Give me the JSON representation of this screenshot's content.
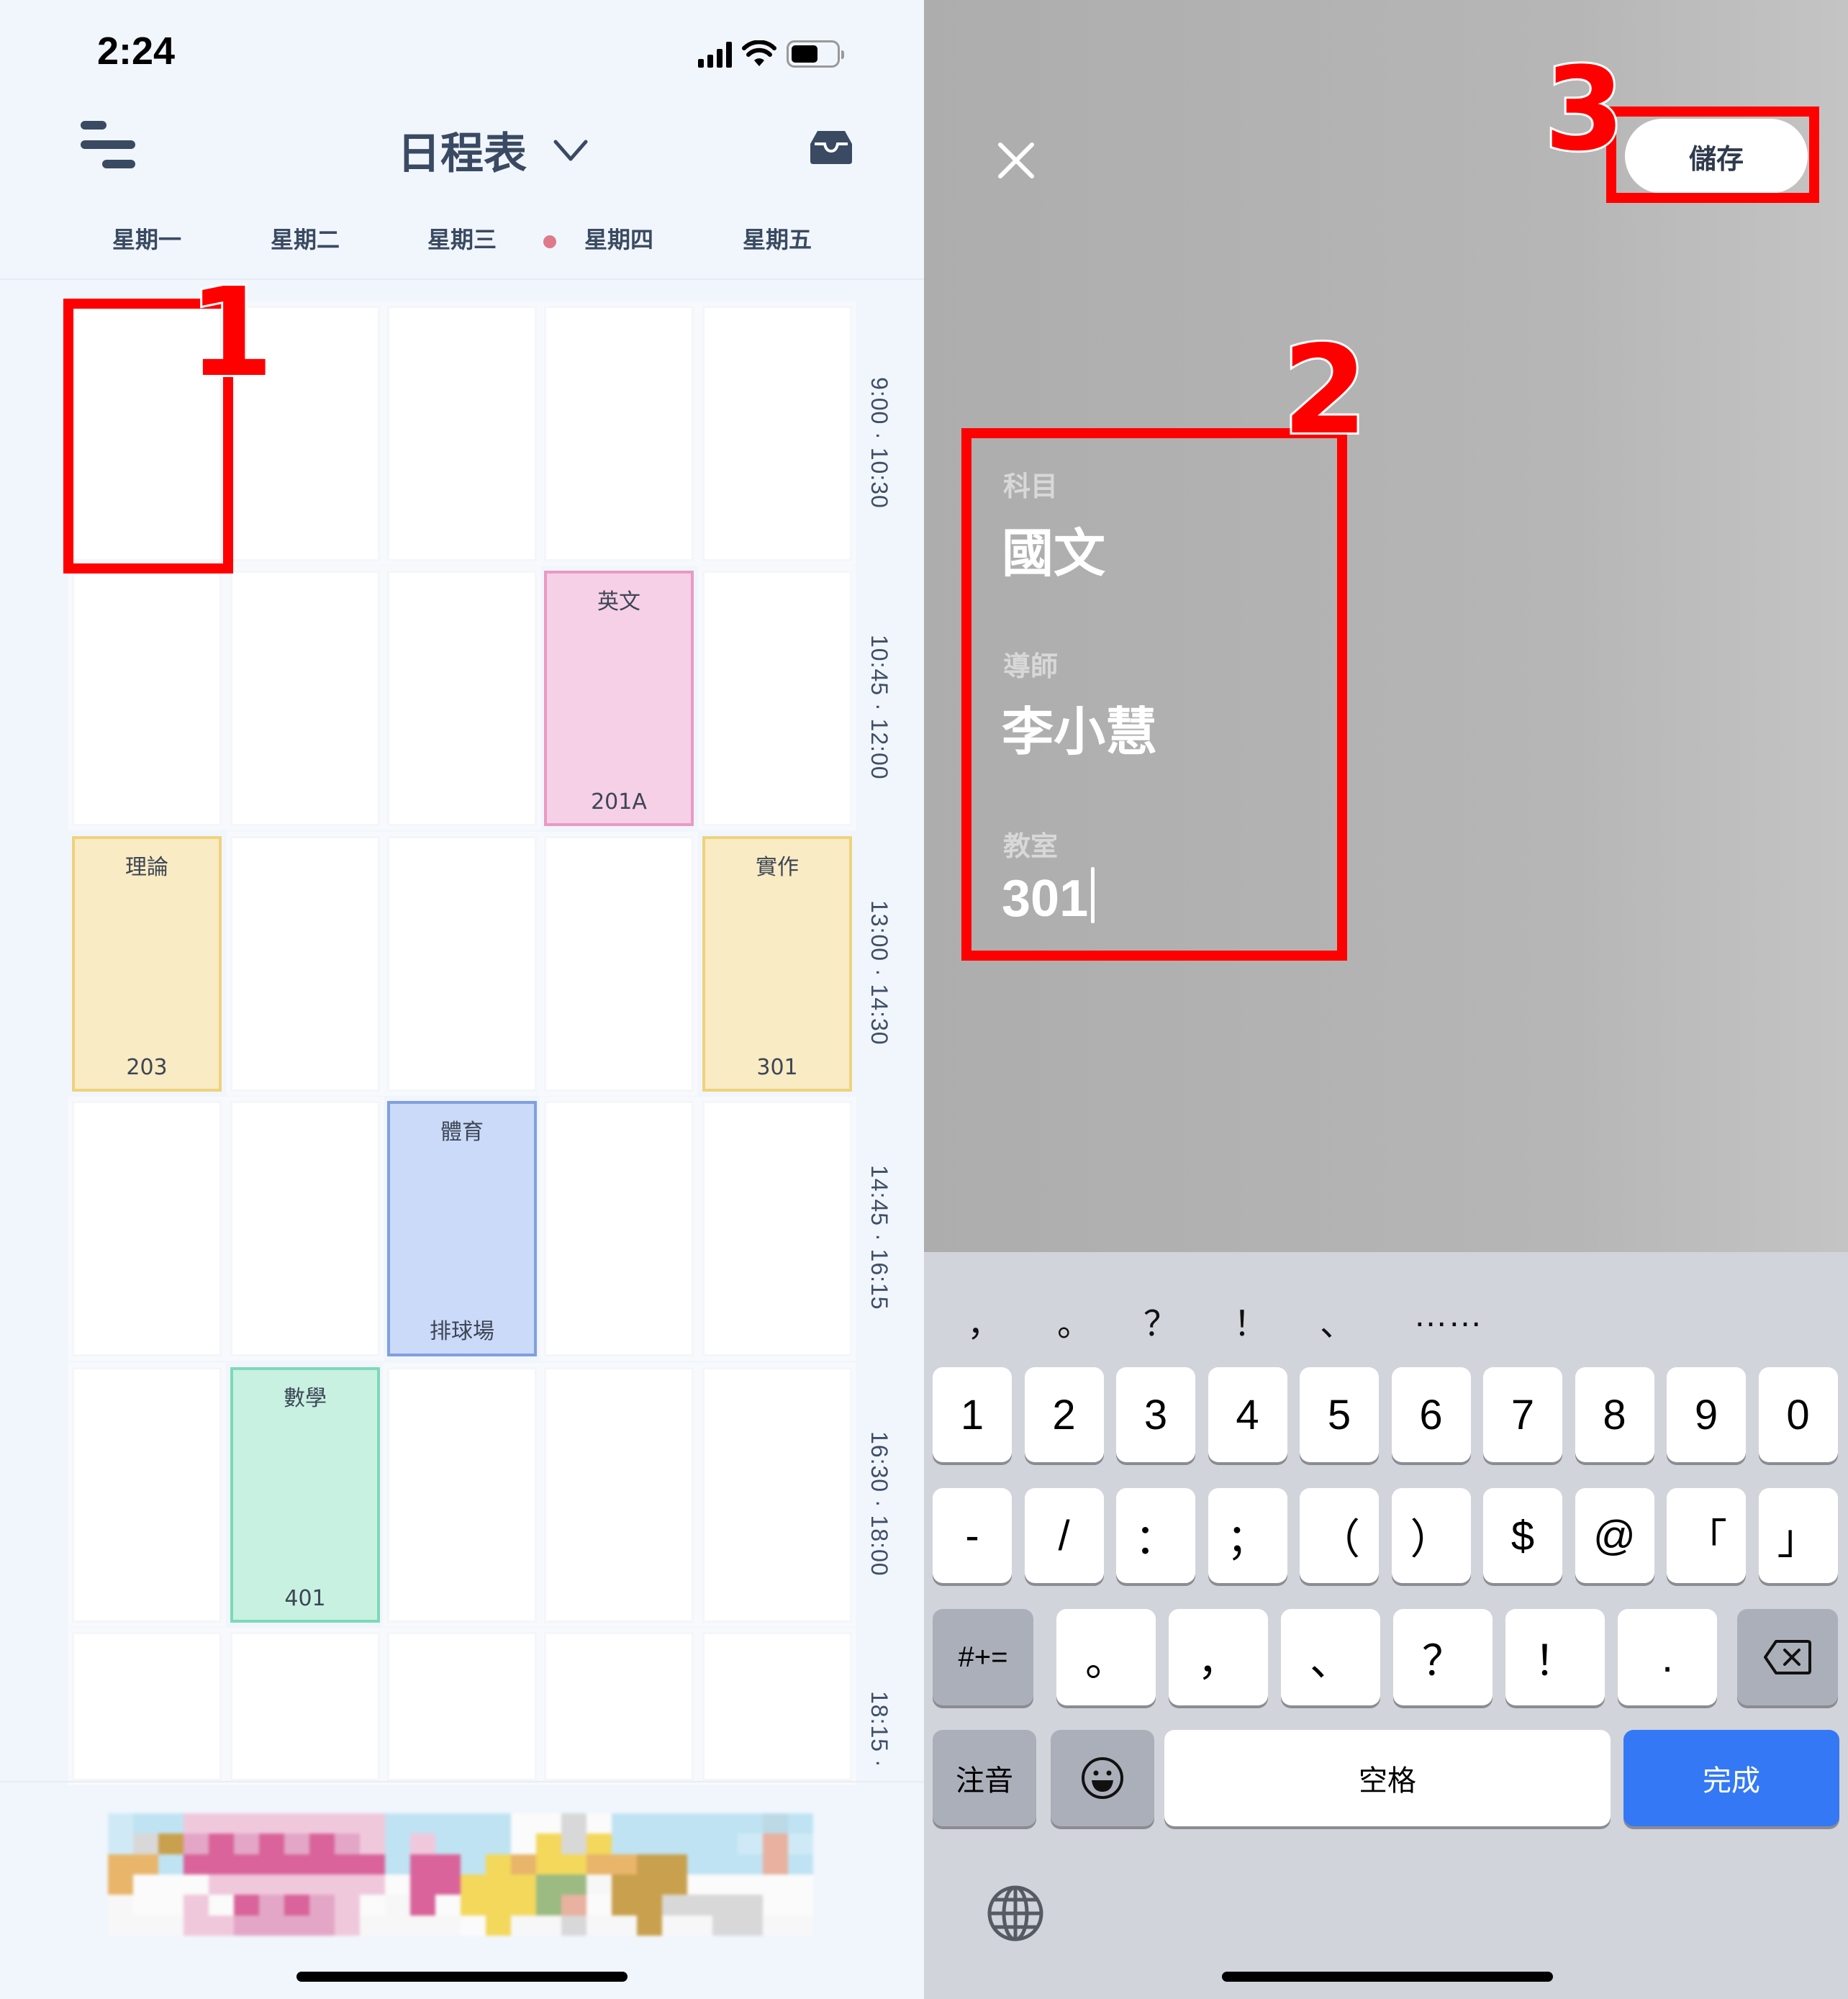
{
  "left_screen": {
    "status_bar": {
      "time": "2:24",
      "battery_level": 0.6
    },
    "header": {
      "title": "日程表",
      "menu_icon": "menu-icon",
      "dropdown_icon": "chevron-down-icon",
      "inbox_icon": "inbox-icon"
    },
    "weekdays": [
      "星期一",
      "星期二",
      "星期三",
      "星期四",
      "星期五"
    ],
    "today_index": 3,
    "time_slots": [
      {
        "label": "9:00 · 10:30"
      },
      {
        "label": "10:45 · 12:00"
      },
      {
        "label": "13:00 · 14:30"
      },
      {
        "label": "14:45 · 16:15"
      },
      {
        "label": "16:30 · 18:00"
      },
      {
        "label": "18:15 ·"
      }
    ],
    "classes": [
      {
        "subject": "英文",
        "room": "201A",
        "day": 3,
        "slot": 1,
        "color": "#f6d0e6",
        "border": "#e89ac4"
      },
      {
        "subject": "理論",
        "room": "203",
        "day": 0,
        "slot": 2,
        "color": "#f9ebc3",
        "border": "#efd27e"
      },
      {
        "subject": "實作",
        "room": "301",
        "day": 4,
        "slot": 2,
        "color": "#f9ebc3",
        "border": "#efd27e"
      },
      {
        "subject": "體育",
        "room": "排球場",
        "day": 2,
        "slot": 3,
        "color": "#cbdaf8",
        "border": "#7f9fe0"
      },
      {
        "subject": "數學",
        "room": "401",
        "day": 1,
        "slot": 4,
        "color": "#c8f1e2",
        "border": "#7dd9b6"
      }
    ],
    "annotation": {
      "number": "1",
      "target": "星期一 9:00 slot"
    }
  },
  "right_screen": {
    "close_icon": "close-icon",
    "save_label": "儲存",
    "form": {
      "subject_label": "科目",
      "subject_value": "國文",
      "teacher_label": "導師",
      "teacher_value": "李小慧",
      "room_label": "教室",
      "room_value": "301"
    },
    "annotations": [
      "2",
      "3"
    ],
    "keyboard": {
      "suggestions": [
        "，",
        "。",
        "？",
        "！",
        "、",
        "……"
      ],
      "row1": [
        "1",
        "2",
        "3",
        "4",
        "5",
        "6",
        "7",
        "8",
        "9",
        "0"
      ],
      "row2": [
        "-",
        "/",
        "：",
        "；",
        "（",
        "）",
        "$",
        "@",
        "「",
        "」"
      ],
      "row3_left": "#+=",
      "row3": [
        "。",
        "，",
        "、",
        "？",
        "！",
        "."
      ],
      "row3_right_icon": "backspace-icon",
      "row4": {
        "mode": "注音",
        "emoji_icon": "emoji-icon",
        "space": "空格",
        "done": "完成"
      },
      "globe_icon": "globe-icon",
      "mic_icon": "microphone-icon"
    }
  },
  "colors": {
    "accent_red": "#ff0000",
    "done_blue": "#3478f6",
    "text_dark": "#3a4a62"
  }
}
